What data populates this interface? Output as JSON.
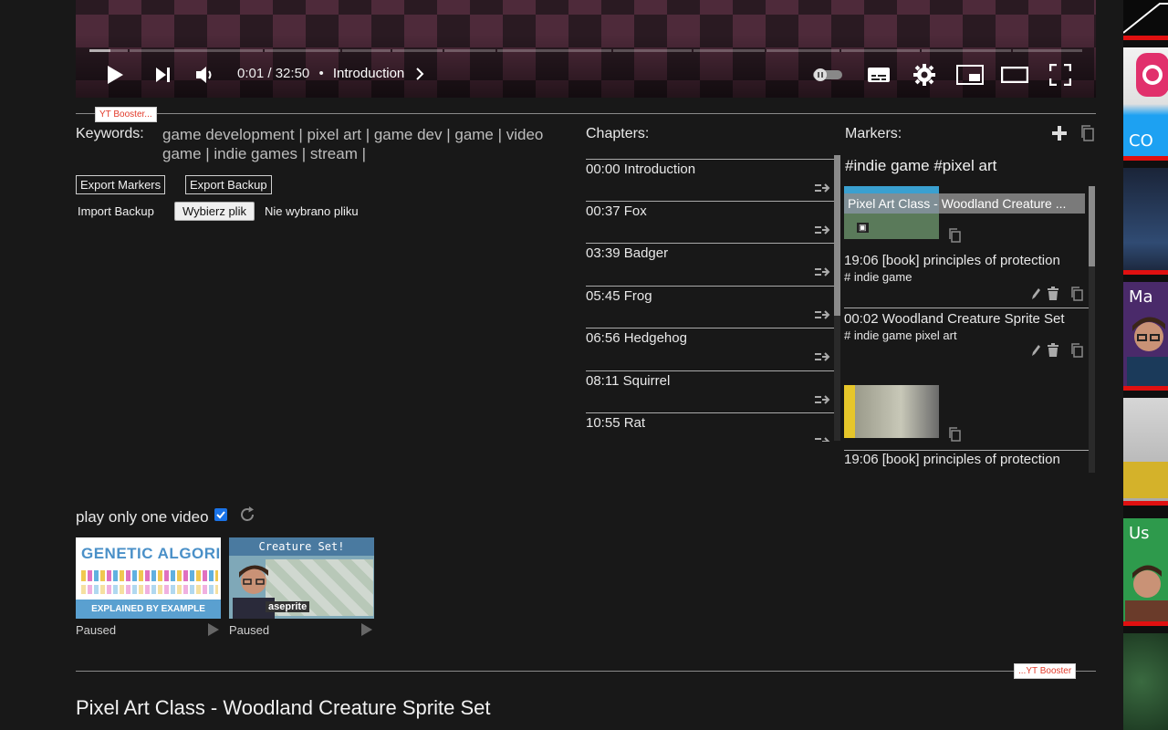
{
  "player": {
    "progress_fraction": 0.0005,
    "time_current": "0:01",
    "time_total": "32:50",
    "separator": "/",
    "chapter": "Introduction"
  },
  "booster": {
    "tag_top": "YT Booster...",
    "tag_bottom": "...YT Booster",
    "keywords_label": "Keywords:",
    "keywords": "game development | pixel art | game dev | game | video game | indie games | stream |",
    "export_markers": "Export Markers",
    "export_backup": "Export Backup",
    "import_backup": "Import Backup",
    "choose_file": "Wybierz plik",
    "no_file": "Nie wybrano pliku",
    "chapters_label": "Chapters:",
    "chapters": [
      {
        "time": "00:00",
        "title": "Introduction"
      },
      {
        "time": "00:37",
        "title": "Fox"
      },
      {
        "time": "03:39",
        "title": "Badger"
      },
      {
        "time": "05:45",
        "title": "Frog"
      },
      {
        "time": "06:56",
        "title": "Hedgehog"
      },
      {
        "time": "08:11",
        "title": "Squirrel"
      },
      {
        "time": "10:55",
        "title": "Rat"
      }
    ],
    "markers_label": "Markers:",
    "marker_tags": "#indie game  #pixel art",
    "markers": [
      {
        "overlay_title": "Pixel Art Class - Woodland Creature ...",
        "text": "19:06 [book] principles of protection",
        "tags": "# indie game"
      },
      {
        "text": "00:02 Woodland Creature Sprite Set",
        "tags": "# indie game  pixel art"
      },
      {
        "text": "19:06 [book] principles of protection"
      }
    ],
    "play_only_one": "play only one video",
    "playlist": [
      {
        "status": "Paused",
        "title_line1": "GENETIC ALGORITHMS",
        "subtitle": "EXPLAINED BY EXAMPLE"
      },
      {
        "status": "Paused",
        "banner": "Creature Set!",
        "brand": "aseprite"
      }
    ]
  },
  "video_title": "Pixel Art Class - Woodland Creature Sprite Set",
  "right_strip": [
    {
      "text": ""
    },
    {
      "text": "CO"
    },
    {
      "text": ""
    },
    {
      "text": "Ma"
    },
    {
      "text": ""
    },
    {
      "text": "Us"
    },
    {
      "text": ""
    }
  ],
  "colors": {
    "background": "#181818",
    "accent_red": "#e01010",
    "tag_text": "#e23a2a",
    "checkbox": "#1a73e8"
  }
}
